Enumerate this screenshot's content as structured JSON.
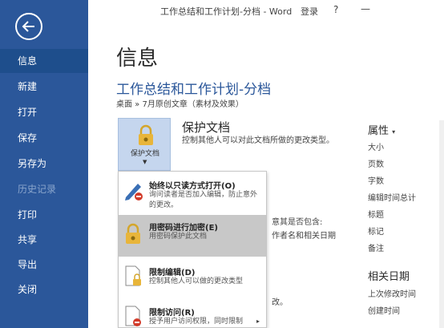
{
  "window": {
    "title": "工作总结和工作计划-分档 - Word",
    "login": "登录",
    "help": "?",
    "minimize": "—"
  },
  "nav": {
    "items": [
      {
        "label": "信息"
      },
      {
        "label": "新建"
      },
      {
        "label": "打开"
      },
      {
        "label": "保存"
      },
      {
        "label": "另存为"
      },
      {
        "label": "历史记录"
      },
      {
        "label": "打印"
      },
      {
        "label": "共享"
      },
      {
        "label": "导出"
      },
      {
        "label": "关闭"
      }
    ]
  },
  "main": {
    "page_title": "信息",
    "doc_title": "工作总结和工作计划-分档",
    "breadcrumb": "桌面 » 7月原创文章（素材及效果）",
    "protect": {
      "button_label": "保护文档",
      "heading": "保护文档",
      "description": "控制其他人可以对此文档所做的更改类型。"
    },
    "fragments": {
      "a": "意其是否包含:",
      "b": "作者名和相关日期",
      "c": "改。"
    }
  },
  "menu": {
    "items": [
      {
        "title": "始终以只读方式打开(O)",
        "desc": "询问读者是否加入编辑，防止意外的更改。",
        "icon": "pencil-no-icon"
      },
      {
        "title": "用密码进行加密(E)",
        "desc": "用密码保护此文档",
        "icon": "lock-key-icon"
      },
      {
        "title": "限制编辑(D)",
        "desc": "控制其他人可以做的更改类型",
        "icon": "document-lock-icon"
      },
      {
        "title": "限制访问(R)",
        "desc": "授予用户访问权限，同时限制",
        "icon": "restrict-access-icon"
      }
    ]
  },
  "properties": {
    "heading": "属性",
    "labels": [
      "大小",
      "页数",
      "字数",
      "编辑时间总计",
      "标题",
      "标记",
      "备注"
    ],
    "related_heading": "相关日期",
    "related_labels": [
      "上次修改时间",
      "创建时间"
    ]
  },
  "colors": {
    "nav_bg": "#2b579a",
    "accent": "#2b579a"
  }
}
